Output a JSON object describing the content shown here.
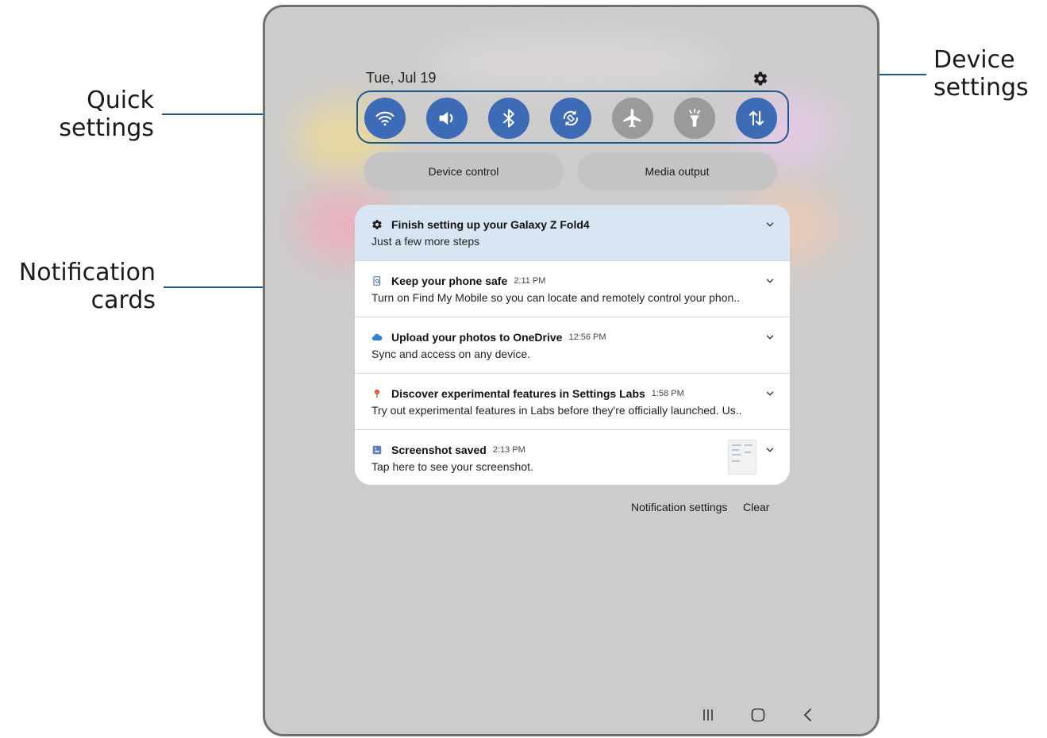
{
  "callouts": {
    "quick_settings": [
      "Quick",
      "settings"
    ],
    "notification_cards": [
      "Notification",
      "cards"
    ],
    "device_settings": [
      "Device",
      "settings"
    ]
  },
  "panel": {
    "date": "Tue, Jul 19",
    "quick_settings": [
      {
        "icon": "wifi-icon",
        "state": "on"
      },
      {
        "icon": "sound-icon",
        "state": "on"
      },
      {
        "icon": "bluetooth-icon",
        "state": "on"
      },
      {
        "icon": "auto-rotate-icon",
        "state": "on"
      },
      {
        "icon": "airplane-mode-icon",
        "state": "off"
      },
      {
        "icon": "flashlight-icon",
        "state": "off"
      },
      {
        "icon": "mobile-data-icon",
        "state": "on"
      }
    ],
    "device_control_label": "Device control",
    "media_output_label": "Media output",
    "notifications": [
      {
        "icon": "gear-icon",
        "title": "Finish setting up your Galaxy Z Fold4",
        "time": "",
        "body": "Just a few more steps"
      },
      {
        "icon": "find-mobile-icon",
        "title": "Keep your phone safe",
        "time": "2:11 PM",
        "body": "Turn on Find My Mobile so you can locate and remotely control your phon.."
      },
      {
        "icon": "onedrive-cloud-icon",
        "title": "Upload your photos to OneDrive",
        "time": "12:56 PM",
        "body": "Sync and access on any device."
      },
      {
        "icon": "settings-labs-icon",
        "title": "Discover experimental features in Settings Labs",
        "time": "1:58 PM",
        "body": "Try out experimental features in Labs before they're officially launched. Us.."
      },
      {
        "icon": "screenshot-icon",
        "title": "Screenshot saved",
        "time": "2:13 PM",
        "body": "Tap here to see your screenshot."
      }
    ],
    "notification_settings_label": "Notification settings",
    "clear_label": "Clear"
  },
  "colors": {
    "accent": "#3e6bb5",
    "callout_line": "#1d5a8c",
    "highlight_card": "#d7e6f2"
  }
}
